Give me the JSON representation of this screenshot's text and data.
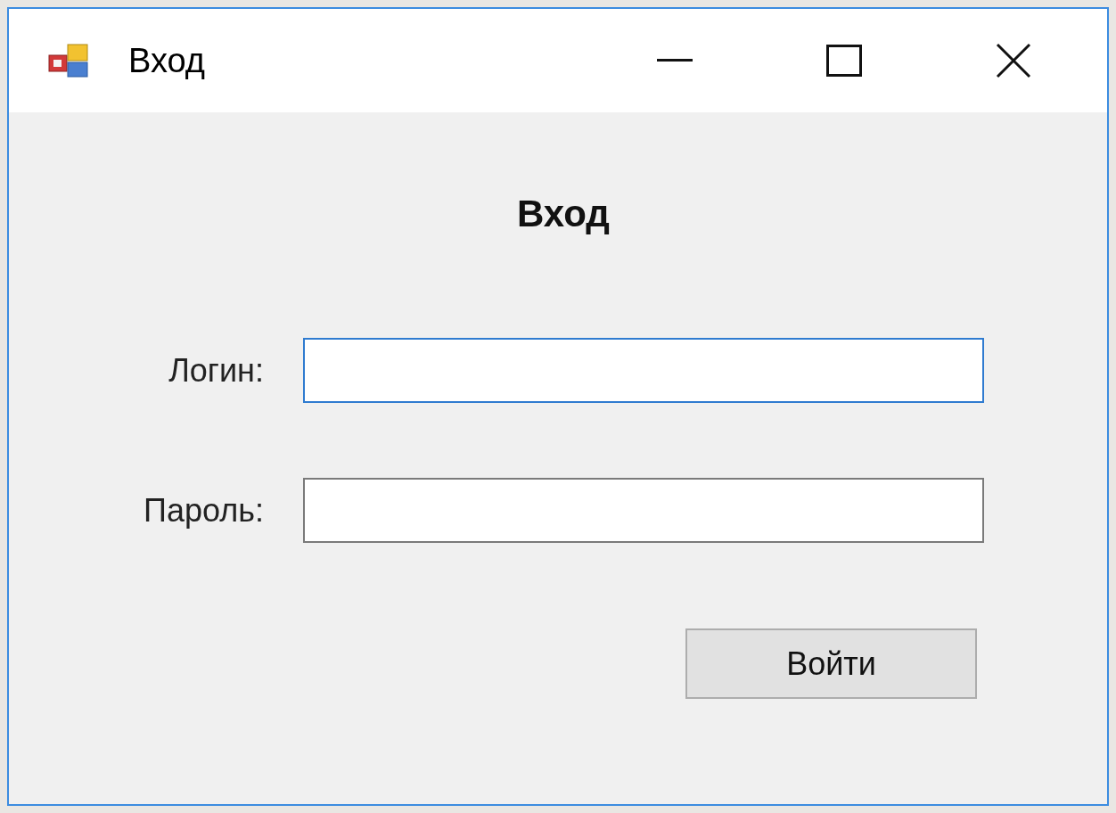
{
  "window": {
    "title": "Вход"
  },
  "heading": "Вход",
  "fields": [
    {
      "label": "Логин:",
      "focused": true
    },
    {
      "label": "Пароль:",
      "focused": false
    }
  ],
  "button": "Войти"
}
